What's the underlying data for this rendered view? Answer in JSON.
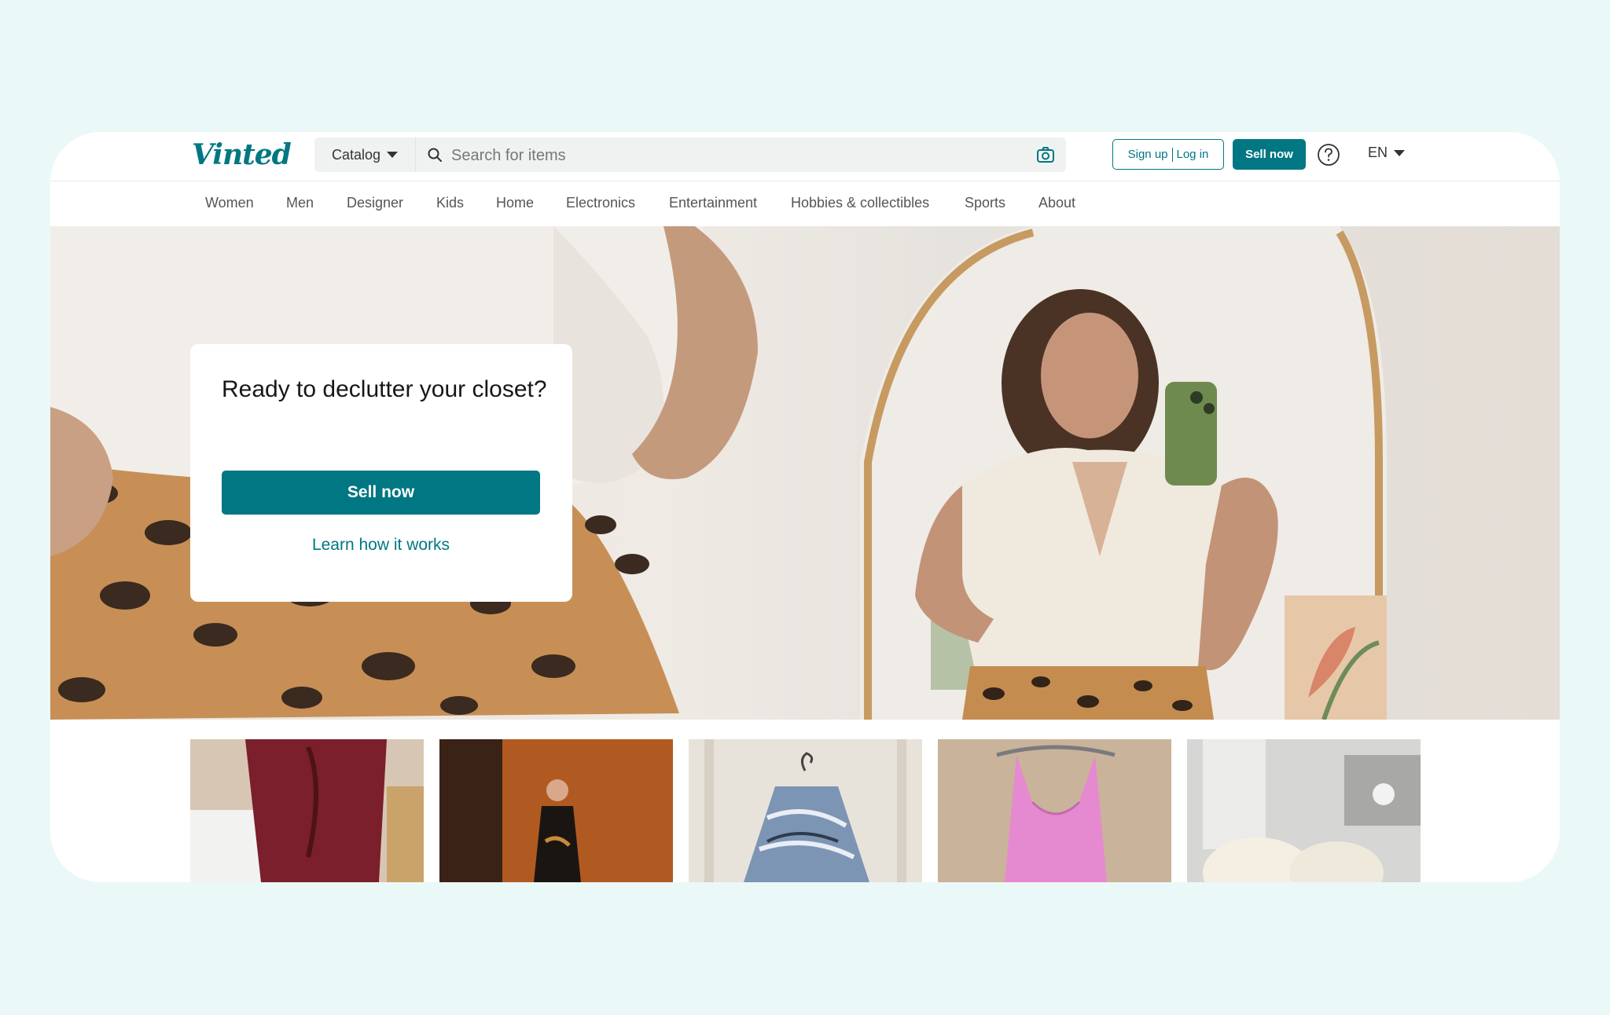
{
  "header": {
    "logo": "Vinted",
    "catalog_label": "Catalog",
    "search_placeholder": "Search for items",
    "signup_label": "Sign up",
    "login_label": "Log in",
    "sell_now_label": "Sell now",
    "language": "EN"
  },
  "nav": {
    "items": [
      "Women",
      "Men",
      "Designer",
      "Kids",
      "Home",
      "Electronics",
      "Entertainment",
      "Hobbies & collectibles",
      "Sports",
      "About"
    ]
  },
  "hero": {
    "title": "Ready to declutter your closet?",
    "sell_button": "Sell now",
    "learn_link": "Learn how it works"
  },
  "items": [
    "burgundy-boots",
    "black-dress",
    "printed-blouse",
    "pink-dress",
    "white-fluffy-item"
  ],
  "colors": {
    "brand": "#007782",
    "background": "#ebf8f8"
  },
  "icons": [
    "search-icon",
    "camera-icon",
    "help-icon",
    "chevron-down-icon"
  ]
}
